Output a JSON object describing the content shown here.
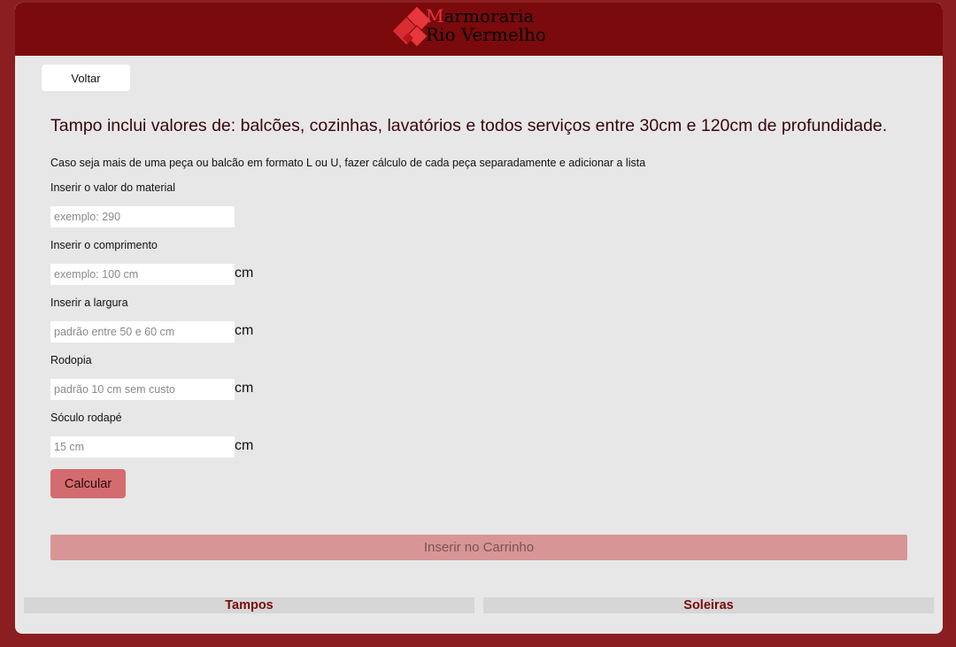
{
  "header": {
    "logo": {
      "line1_accent": "M",
      "line1_rest": "armoraria",
      "line2": "Rio Vermelho"
    }
  },
  "nav": {
    "back_label": "Voltar"
  },
  "main": {
    "title": "Tampo inclui valores de: balcões, cozinhas, lavatórios e todos serviços entre 30cm e 120cm de profundidade.",
    "note": "Caso seja mais de uma peça ou balcão em formato L ou U, fazer cálculo de cada peça separadamente e adicionar a lista",
    "fields": [
      {
        "label": "Inserir o valor do material",
        "placeholder": "exemplo: 290",
        "unit": ""
      },
      {
        "label": "Inserir o comprimento",
        "placeholder": "exemplo: 100 cm",
        "unit": "cm"
      },
      {
        "label": "Inserir a largura",
        "placeholder": "padrão entre 50 e 60 cm",
        "unit": "cm"
      },
      {
        "label": "Rodopia",
        "placeholder": "padrão 10 cm sem custo",
        "unit": "cm"
      },
      {
        "label": "Sóculo rodapé",
        "placeholder": "15 cm",
        "unit": "cm"
      }
    ],
    "calculate_label": "Calcular",
    "cart_label": "Inserir no Carrinho"
  },
  "footer": {
    "tabs": [
      {
        "label": "Tampos"
      },
      {
        "label": "Soleiras"
      }
    ]
  },
  "colors": {
    "background": "#8b1e21",
    "header": "#7a0a0b",
    "panel": "#e7e7e8",
    "accent": "#e8363d",
    "calculate_button": "#d36b6f",
    "cart_button": "#d89596"
  }
}
